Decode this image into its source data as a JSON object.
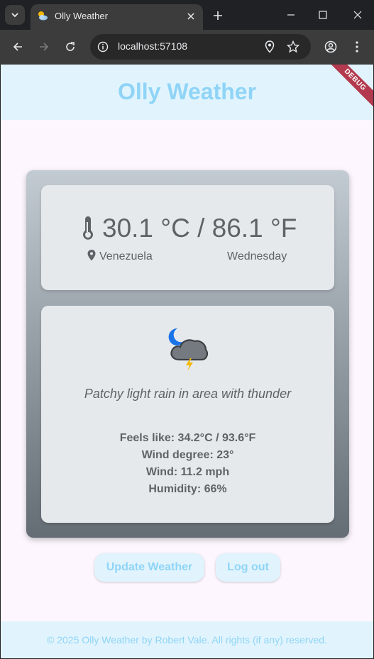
{
  "browser": {
    "tab_title": "Olly Weather",
    "url": "localhost:57108"
  },
  "app": {
    "title": "Olly Weather",
    "debug_banner": "DEBUG",
    "brand_color": "#8fd4f7",
    "bar_color": "#e1f4fd"
  },
  "weather": {
    "temperature": "30.1 °C / 86.1 °F",
    "location": "Venezuela",
    "day": "Wednesday",
    "condition": "Patchy light rain in area with thunder",
    "condition_icon": "night-thunder-rain-cloud-icon",
    "details": [
      "Feels like: 34.2°C / 93.6°F",
      "Wind degree: 23°",
      "Wind: 11.2 mph",
      "Humidity: 66%"
    ]
  },
  "actions": {
    "update_label": "Update Weather",
    "logout_label": "Log out"
  },
  "footer": {
    "text": "© 2025 Olly Weather by Robert Vale. All rights (if any) reserved."
  }
}
